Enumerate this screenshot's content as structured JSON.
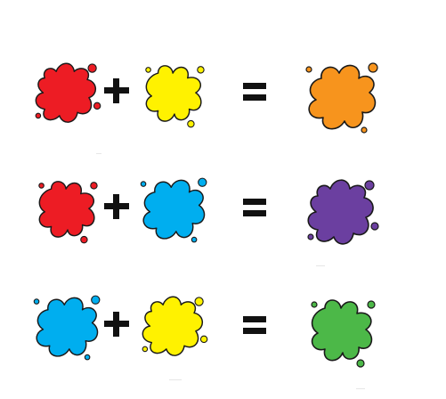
{
  "equations": [
    {
      "first": {
        "color_name": "red",
        "color": "#ED1C24"
      },
      "second": {
        "color_name": "yellow",
        "color": "#FFF200"
      },
      "result": {
        "color_name": "orange",
        "color": "#F7941D"
      }
    },
    {
      "first": {
        "color_name": "red",
        "color": "#ED1C24"
      },
      "second": {
        "color_name": "blue",
        "color": "#00AEEF"
      },
      "result": {
        "color_name": "purple",
        "color": "#6B3FA0"
      }
    },
    {
      "first": {
        "color_name": "blue",
        "color": "#00AEEF"
      },
      "second": {
        "color_name": "yellow",
        "color": "#FFF200"
      },
      "result": {
        "color_name": "green",
        "color": "#4CB848"
      }
    }
  ],
  "operators": {
    "plus_icon": "plus-icon",
    "equals_icon": "equals-icon",
    "color": "#111111"
  },
  "outline_color": "#1a1a1a"
}
